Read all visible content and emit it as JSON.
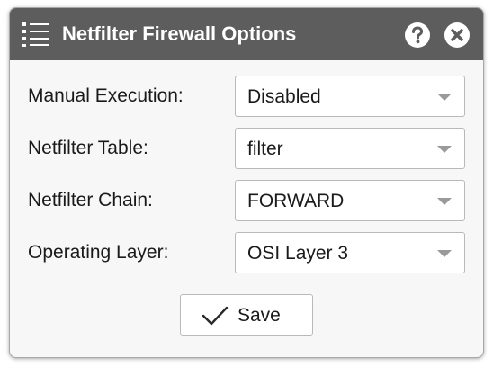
{
  "dialog": {
    "title": "Netfilter Firewall Options",
    "menu_icon": "list-menu-icon",
    "help_icon": "help-icon",
    "close_icon": "close-icon"
  },
  "fields": [
    {
      "label": "Manual Execution:",
      "value": "Disabled"
    },
    {
      "label": "Netfilter Table:",
      "value": "filter"
    },
    {
      "label": "Netfilter Chain:",
      "value": "FORWARD"
    },
    {
      "label": "Operating Layer:",
      "value": "OSI Layer 3"
    }
  ],
  "save": {
    "label": "Save",
    "icon": "checkmark-icon"
  },
  "colors": {
    "titlebar": "#5d5d5d",
    "body": "#f7f7f7",
    "border": "#b9b9b9"
  }
}
